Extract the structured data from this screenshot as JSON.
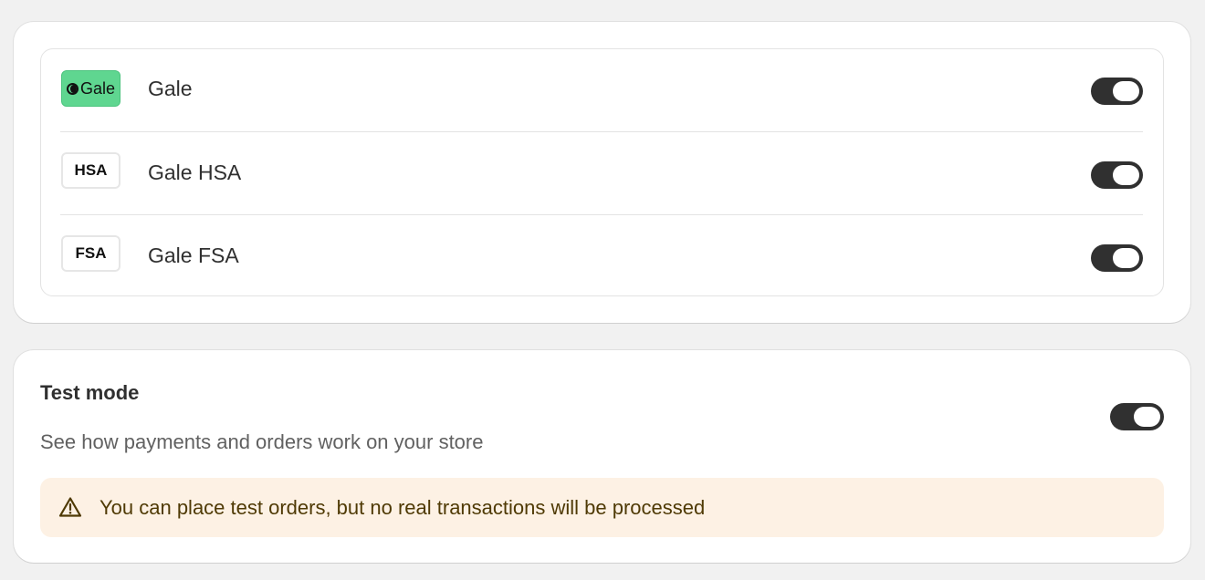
{
  "payment_methods": [
    {
      "name": "Gale",
      "logo_text": "Gale",
      "logo_icon": "gale-logo-icon",
      "enabled": true
    },
    {
      "name": "Gale HSA",
      "logo_text": "HSA",
      "enabled": true
    },
    {
      "name": "Gale FSA",
      "logo_text": "FSA",
      "enabled": true
    }
  ],
  "test_mode": {
    "title": "Test mode",
    "description": "See how payments and orders work on your store",
    "enabled": true,
    "banner": {
      "icon": "warning-icon",
      "text": "You can place test orders, but no real transactions will be processed"
    }
  },
  "colors": {
    "page_bg": "#f1f1f1",
    "toggle_on": "#303030",
    "gale_brand": "#5fd690",
    "banner_bg": "#fdf1e4",
    "banner_text": "#4f3a05"
  }
}
